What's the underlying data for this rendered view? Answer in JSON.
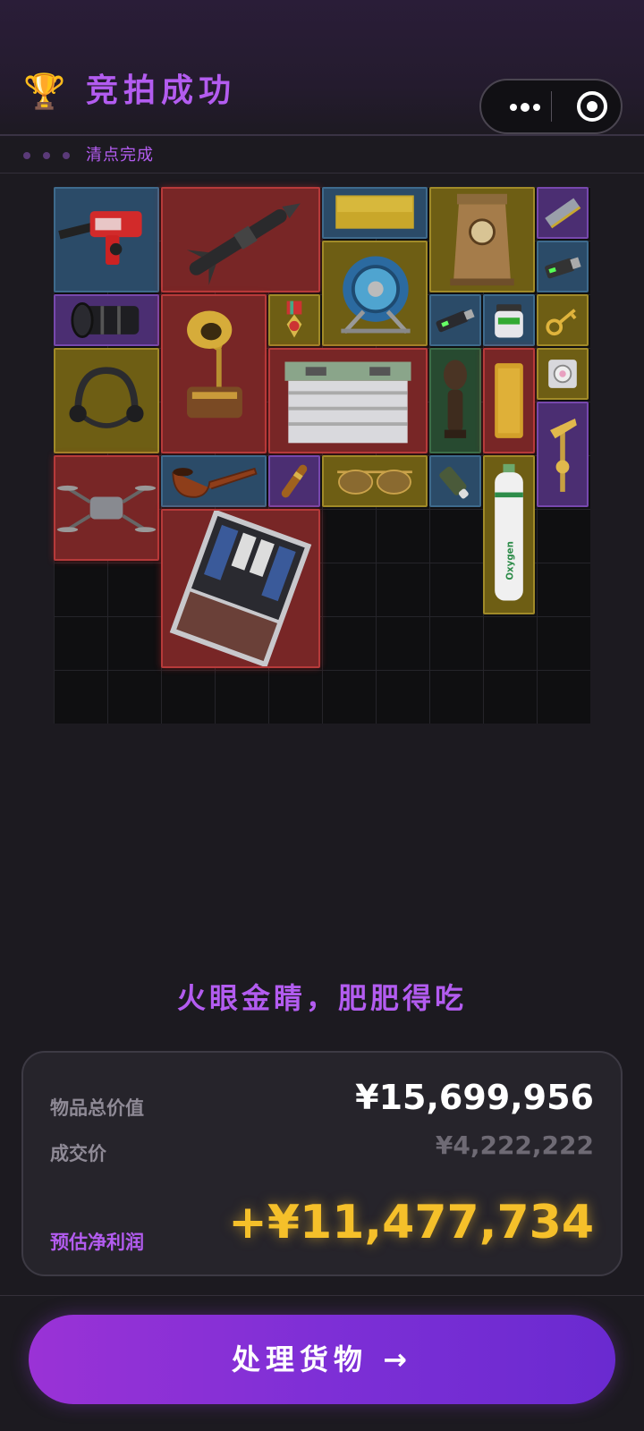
{
  "header": {
    "title": "竞拍成功",
    "trophy_icon": "trophy-icon",
    "menu_icon": "more-dots-icon",
    "close_icon": "target-circle-icon"
  },
  "status": {
    "text": "清点完成"
  },
  "items": [
    {
      "name": "rotary-hammer",
      "rarity": "blue"
    },
    {
      "name": "missile",
      "rarity": "red"
    },
    {
      "name": "gold-bar-plate",
      "rarity": "blue"
    },
    {
      "name": "clock",
      "rarity": "gold"
    },
    {
      "name": "memory-stick",
      "rarity": "purple"
    },
    {
      "name": "hose-reel",
      "rarity": "gold"
    },
    {
      "name": "usb-drive",
      "rarity": "blue"
    },
    {
      "name": "camera-lens",
      "rarity": "purple"
    },
    {
      "name": "phonograph",
      "rarity": "red"
    },
    {
      "name": "medal",
      "rarity": "gold"
    },
    {
      "name": "usb-stick",
      "rarity": "blue"
    },
    {
      "name": "jar",
      "rarity": "blue"
    },
    {
      "name": "golden-key",
      "rarity": "gold"
    },
    {
      "name": "headset",
      "rarity": "gold"
    },
    {
      "name": "battery",
      "rarity": "red"
    },
    {
      "name": "statue",
      "rarity": "green"
    },
    {
      "name": "gold-ingot",
      "rarity": "red"
    },
    {
      "name": "companion-cube",
      "rarity": "gold"
    },
    {
      "name": "gold-hammer",
      "rarity": "purple"
    },
    {
      "name": "drone",
      "rarity": "red"
    },
    {
      "name": "pipe",
      "rarity": "blue"
    },
    {
      "name": "cigar",
      "rarity": "purple"
    },
    {
      "name": "sunglasses",
      "rarity": "gold"
    },
    {
      "name": "lighter",
      "rarity": "blue"
    },
    {
      "name": "oxygen-tank",
      "rarity": "gold",
      "text": "Oxygen"
    },
    {
      "name": "server",
      "rarity": "red"
    }
  ],
  "slogan": "火眼金睛，肥肥得吃",
  "summary": {
    "total_label": "物品总价值",
    "total_value": "¥15,699,956",
    "deal_label": "成交价",
    "deal_value": "¥4,222,222",
    "profit_label": "预估净利润",
    "profit_value": "+¥11,477,734"
  },
  "action": {
    "label": "处理货物 →"
  },
  "colors": {
    "accent": "#b35cf0",
    "profit": "#f5c02a",
    "button_start": "#9a32d6",
    "button_end": "#6a2ad0"
  }
}
